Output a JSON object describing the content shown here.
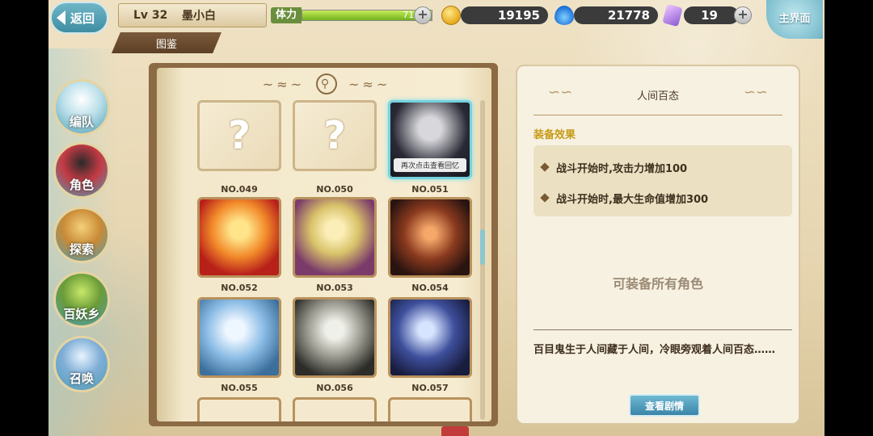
{
  "header": {
    "back_label": "返回",
    "level": "Lv 32",
    "player_name": "墨小白",
    "section_tab": "图鉴",
    "stamina_label": "体力",
    "stamina_value": "71/71",
    "stamina_fraction": 1.0,
    "coins": "19195",
    "soul_flame": "21778",
    "crystals": "19",
    "home_label": "主界面"
  },
  "sidebar": {
    "items": [
      {
        "label": "编队",
        "icon": "ghost-icon"
      },
      {
        "label": "角色",
        "icon": "character-icon"
      },
      {
        "label": "探索",
        "icon": "scroll-icon"
      },
      {
        "label": "百妖乡",
        "icon": "village-icon"
      },
      {
        "label": "召唤",
        "icon": "summon-icon"
      }
    ]
  },
  "collection": {
    "cards": [
      {
        "no": "NO.049",
        "known": false
      },
      {
        "no": "NO.050",
        "known": false
      },
      {
        "no": "NO.051",
        "known": true,
        "selected": true,
        "tip": "再次点击查看回忆"
      },
      {
        "no": "NO.052",
        "known": true
      },
      {
        "no": "NO.053",
        "known": true
      },
      {
        "no": "NO.054",
        "known": true
      },
      {
        "no": "NO.055",
        "known": true
      },
      {
        "no": "NO.056",
        "known": true
      },
      {
        "no": "NO.057",
        "known": true
      }
    ],
    "unknown_glyph": "?"
  },
  "detail": {
    "title": "人间百态",
    "effects_heading": "装备效果",
    "effects": [
      "战斗开始时,攻击力增加100",
      "战斗开始时,最大生命值增加300"
    ],
    "equip_note": "可装备所有角色",
    "description": "百目鬼生于人间藏于人间，冷眼旁观着人间百态……",
    "story_button": "查看剧情"
  },
  "colors": {
    "accent_teal": "#74d3de",
    "gold_heading": "#c79a14",
    "book_brown": "#8c6a44"
  }
}
